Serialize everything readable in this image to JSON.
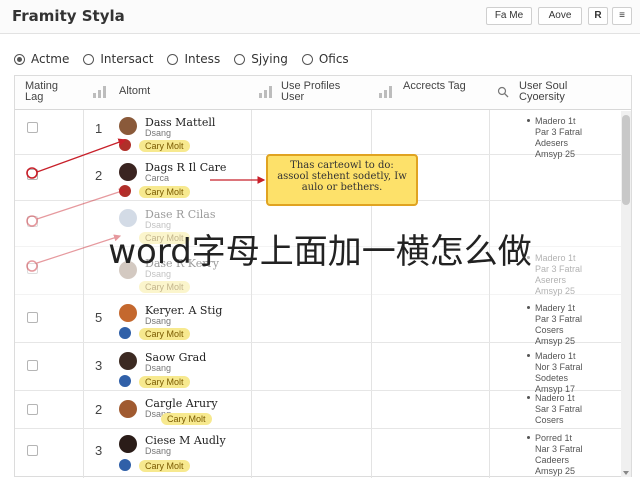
{
  "app": {
    "title": "Framity Styla"
  },
  "toolbar": {
    "btn1": "Fa Me",
    "btn2": "Aove",
    "btn3": "R",
    "btn4": "≡"
  },
  "filters": [
    {
      "label": "Actme",
      "selected": true
    },
    {
      "label": "Intersact",
      "selected": false
    },
    {
      "label": "Intess",
      "selected": false
    },
    {
      "label": "Sjying",
      "selected": false
    },
    {
      "label": "Ofics",
      "selected": false
    }
  ],
  "columns": {
    "c1": "Mating Lag",
    "c2": "Altomt",
    "c3": "Use Profiles User",
    "c4": "Accrects Tag",
    "c5": "User Soul Cyoersity"
  },
  "rows": [
    {
      "num": "1",
      "name": "Dass Mattell",
      "sub": "Dsang",
      "tag": "Cary Molt",
      "ul": [
        "Madero 1t",
        "Par 3 Fatral",
        "Adesers",
        "Amsyp 25"
      ]
    },
    {
      "num": "2",
      "name": "Dags R Il Care",
      "sub": "Carca",
      "tag": "Cary Molt",
      "ul": []
    },
    {
      "num": "",
      "name": "Dase R Cilas",
      "sub": "Dsang",
      "tag": "Cary Molt",
      "ul": []
    },
    {
      "num": "",
      "name": "Dase R Kerry",
      "sub": "Dsang",
      "tag": "Cary Molt",
      "ul": [
        "Madero 1t",
        "Par 3 Fatral",
        "Aserers",
        "Amsyp 25"
      ]
    },
    {
      "num": "5",
      "name": "Keryer. A Stig",
      "sub": "Dsang",
      "tag": "Cary Molt",
      "ul": [
        "Madery 1t",
        "Par 3 Fatral",
        "Cosers",
        "Amsyp 25"
      ]
    },
    {
      "num": "3",
      "name": "Saow Grad",
      "sub": "Dsang",
      "tag": "Cary Molt",
      "ul": [
        "Madero 1t",
        "Nor 3 Fatral",
        "Sodetes",
        "Amsyp 17"
      ]
    },
    {
      "num": "2",
      "name": "Cargle Arury",
      "sub": "Dsang",
      "tag": "Cary Molt",
      "ul": [
        "Nadero 1t",
        "Sar 3 Fatral",
        "Cosers",
        "Amsyp 25"
      ]
    },
    {
      "num": "3",
      "name": "Ciese M Audly",
      "sub": "Dsang",
      "tag": "Cary Molt",
      "ul": [
        "Porred 1t",
        "Nar 3 Fatral",
        "Cadeers",
        "Amsyp 25"
      ]
    }
  ],
  "tooltip": {
    "text": "Thas carteowl to do: assool stehent sodetly, Iw aulo or bethers."
  },
  "watermark": {
    "text": "word字母上面加一横怎么做"
  },
  "colors": {
    "annotation": "#c8202a",
    "tooltip_bg": "#fde16a",
    "tag_bg": "#f7e98f"
  }
}
